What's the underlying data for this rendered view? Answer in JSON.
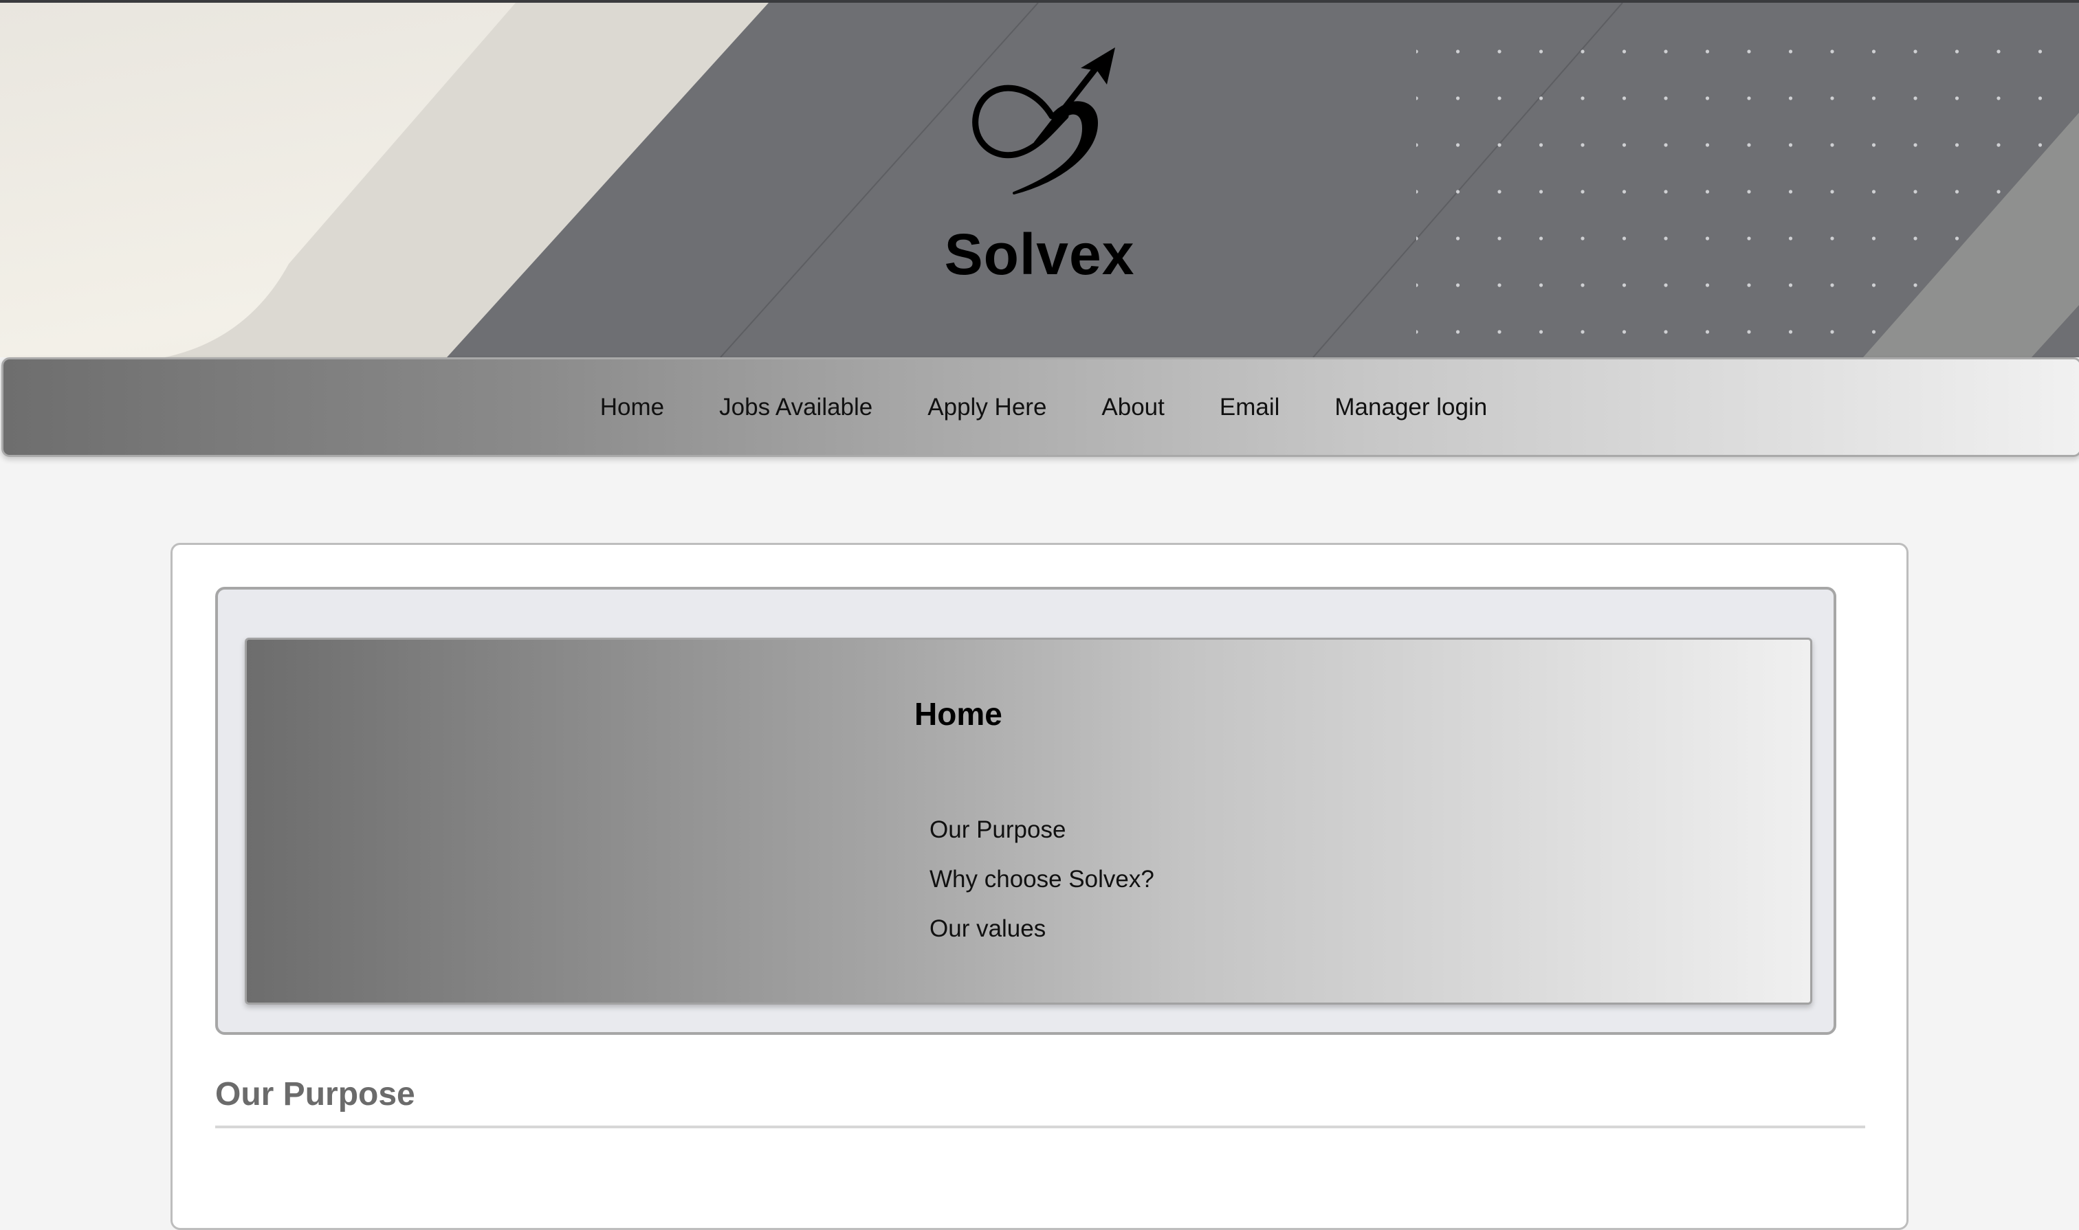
{
  "brand": {
    "name": "Solvex",
    "logo_icon": "infinity-arrow-logo"
  },
  "nav": {
    "items": [
      {
        "label": "Home"
      },
      {
        "label": "Jobs Available"
      },
      {
        "label": "Apply Here"
      },
      {
        "label": "About"
      },
      {
        "label": "Email"
      },
      {
        "label": "Manager login"
      }
    ]
  },
  "toc": {
    "title": "Home",
    "items": [
      {
        "label": "Our Purpose"
      },
      {
        "label": "Why choose Solvex?"
      },
      {
        "label": "Our values"
      }
    ]
  },
  "sections": [
    {
      "heading": "Our Purpose"
    }
  ],
  "colors": {
    "banner_grey": "#6e6f73",
    "banner_cream": "#ece8df",
    "heading_grey": "#6b6b6b"
  }
}
